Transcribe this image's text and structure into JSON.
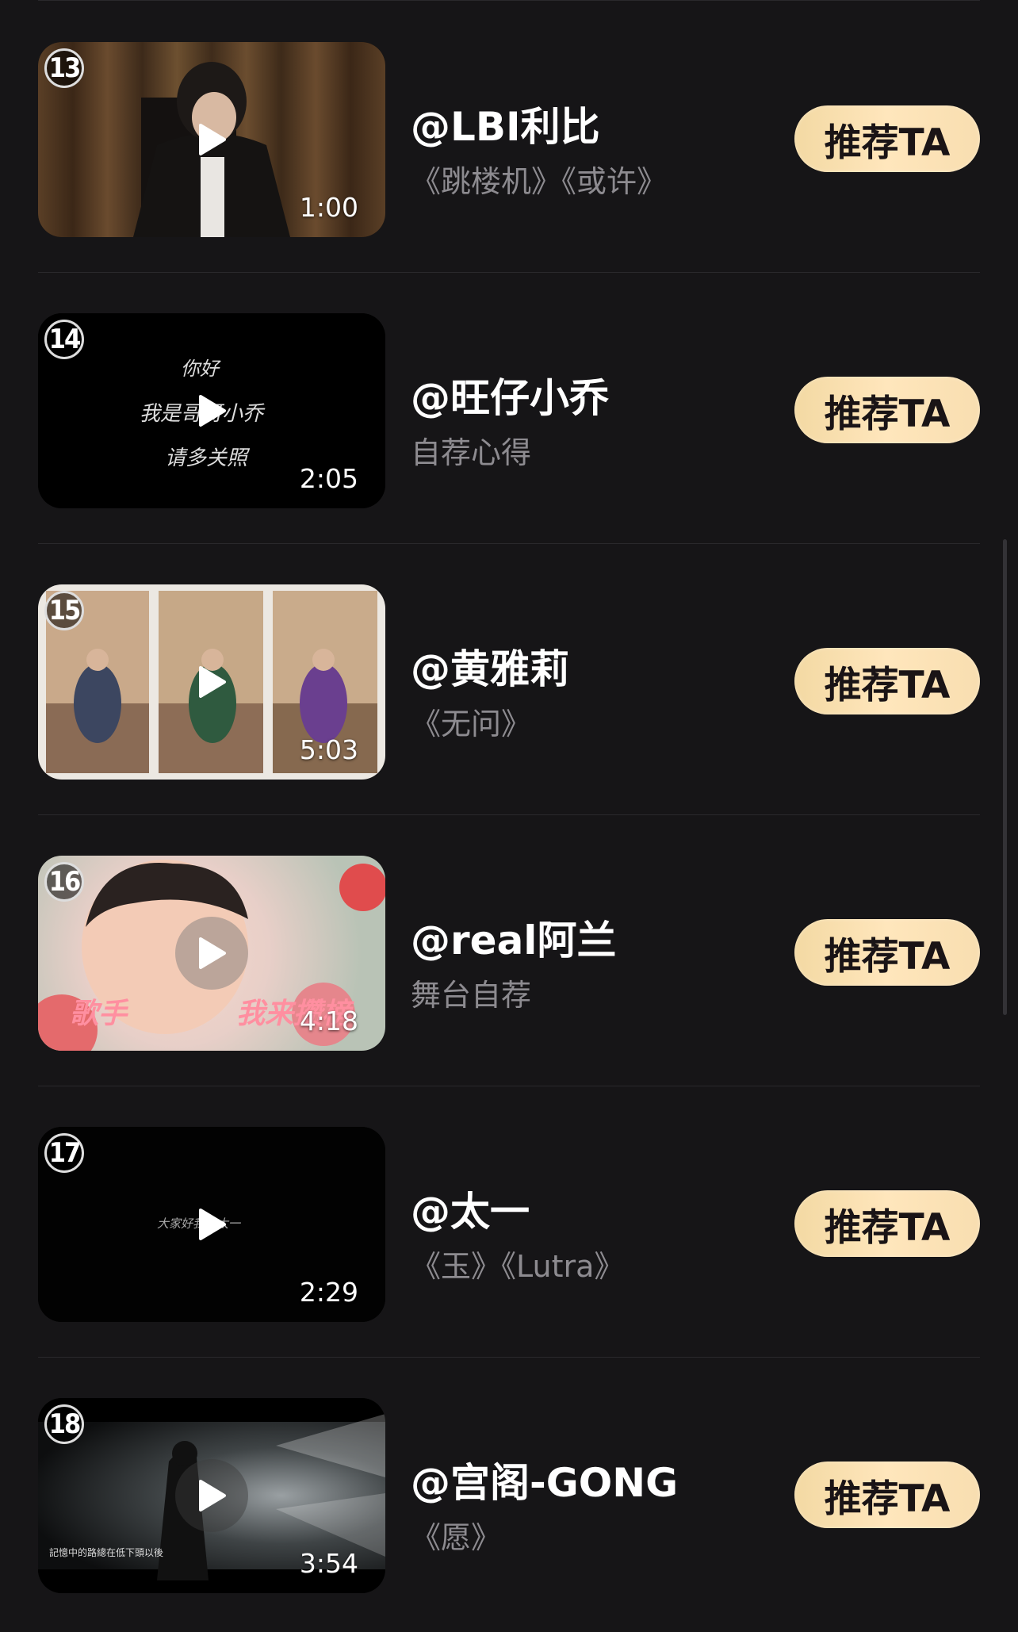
{
  "items": [
    {
      "rank": "13",
      "user": "@LBI利比",
      "sub": "《跳楼机》《或许》",
      "duration": "1:00",
      "button": "推荐TA"
    },
    {
      "rank": "14",
      "user": "@旺仔小乔",
      "sub": "自荐心得",
      "duration": "2:05",
      "button": "推荐TA",
      "thumb_text": [
        "你好",
        "我是哥哥小乔",
        "请多关照"
      ]
    },
    {
      "rank": "15",
      "user": "@黄雅莉",
      "sub": "《无问》",
      "duration": "5:03",
      "button": "推荐TA"
    },
    {
      "rank": "16",
      "user": "@real阿兰",
      "sub": "舞台自荐",
      "duration": "4:18",
      "button": "推荐TA",
      "thumb_text": [
        "歌手",
        "我来攒榜"
      ]
    },
    {
      "rank": "17",
      "user": "@太一",
      "sub": "《玉》《Lutra》",
      "duration": "2:29",
      "button": "推荐TA",
      "thumb_text": [
        "大家好我是太一"
      ]
    },
    {
      "rank": "18",
      "user": "@宫阁-GONG",
      "sub": "《愿》",
      "duration": "3:54",
      "button": "推荐TA",
      "thumb_text": [
        "記憶中的路總在低下頭以後"
      ]
    }
  ],
  "colors": {
    "background": "#161517",
    "button": "#ffe6bc",
    "subtext": "#8d8b90"
  }
}
